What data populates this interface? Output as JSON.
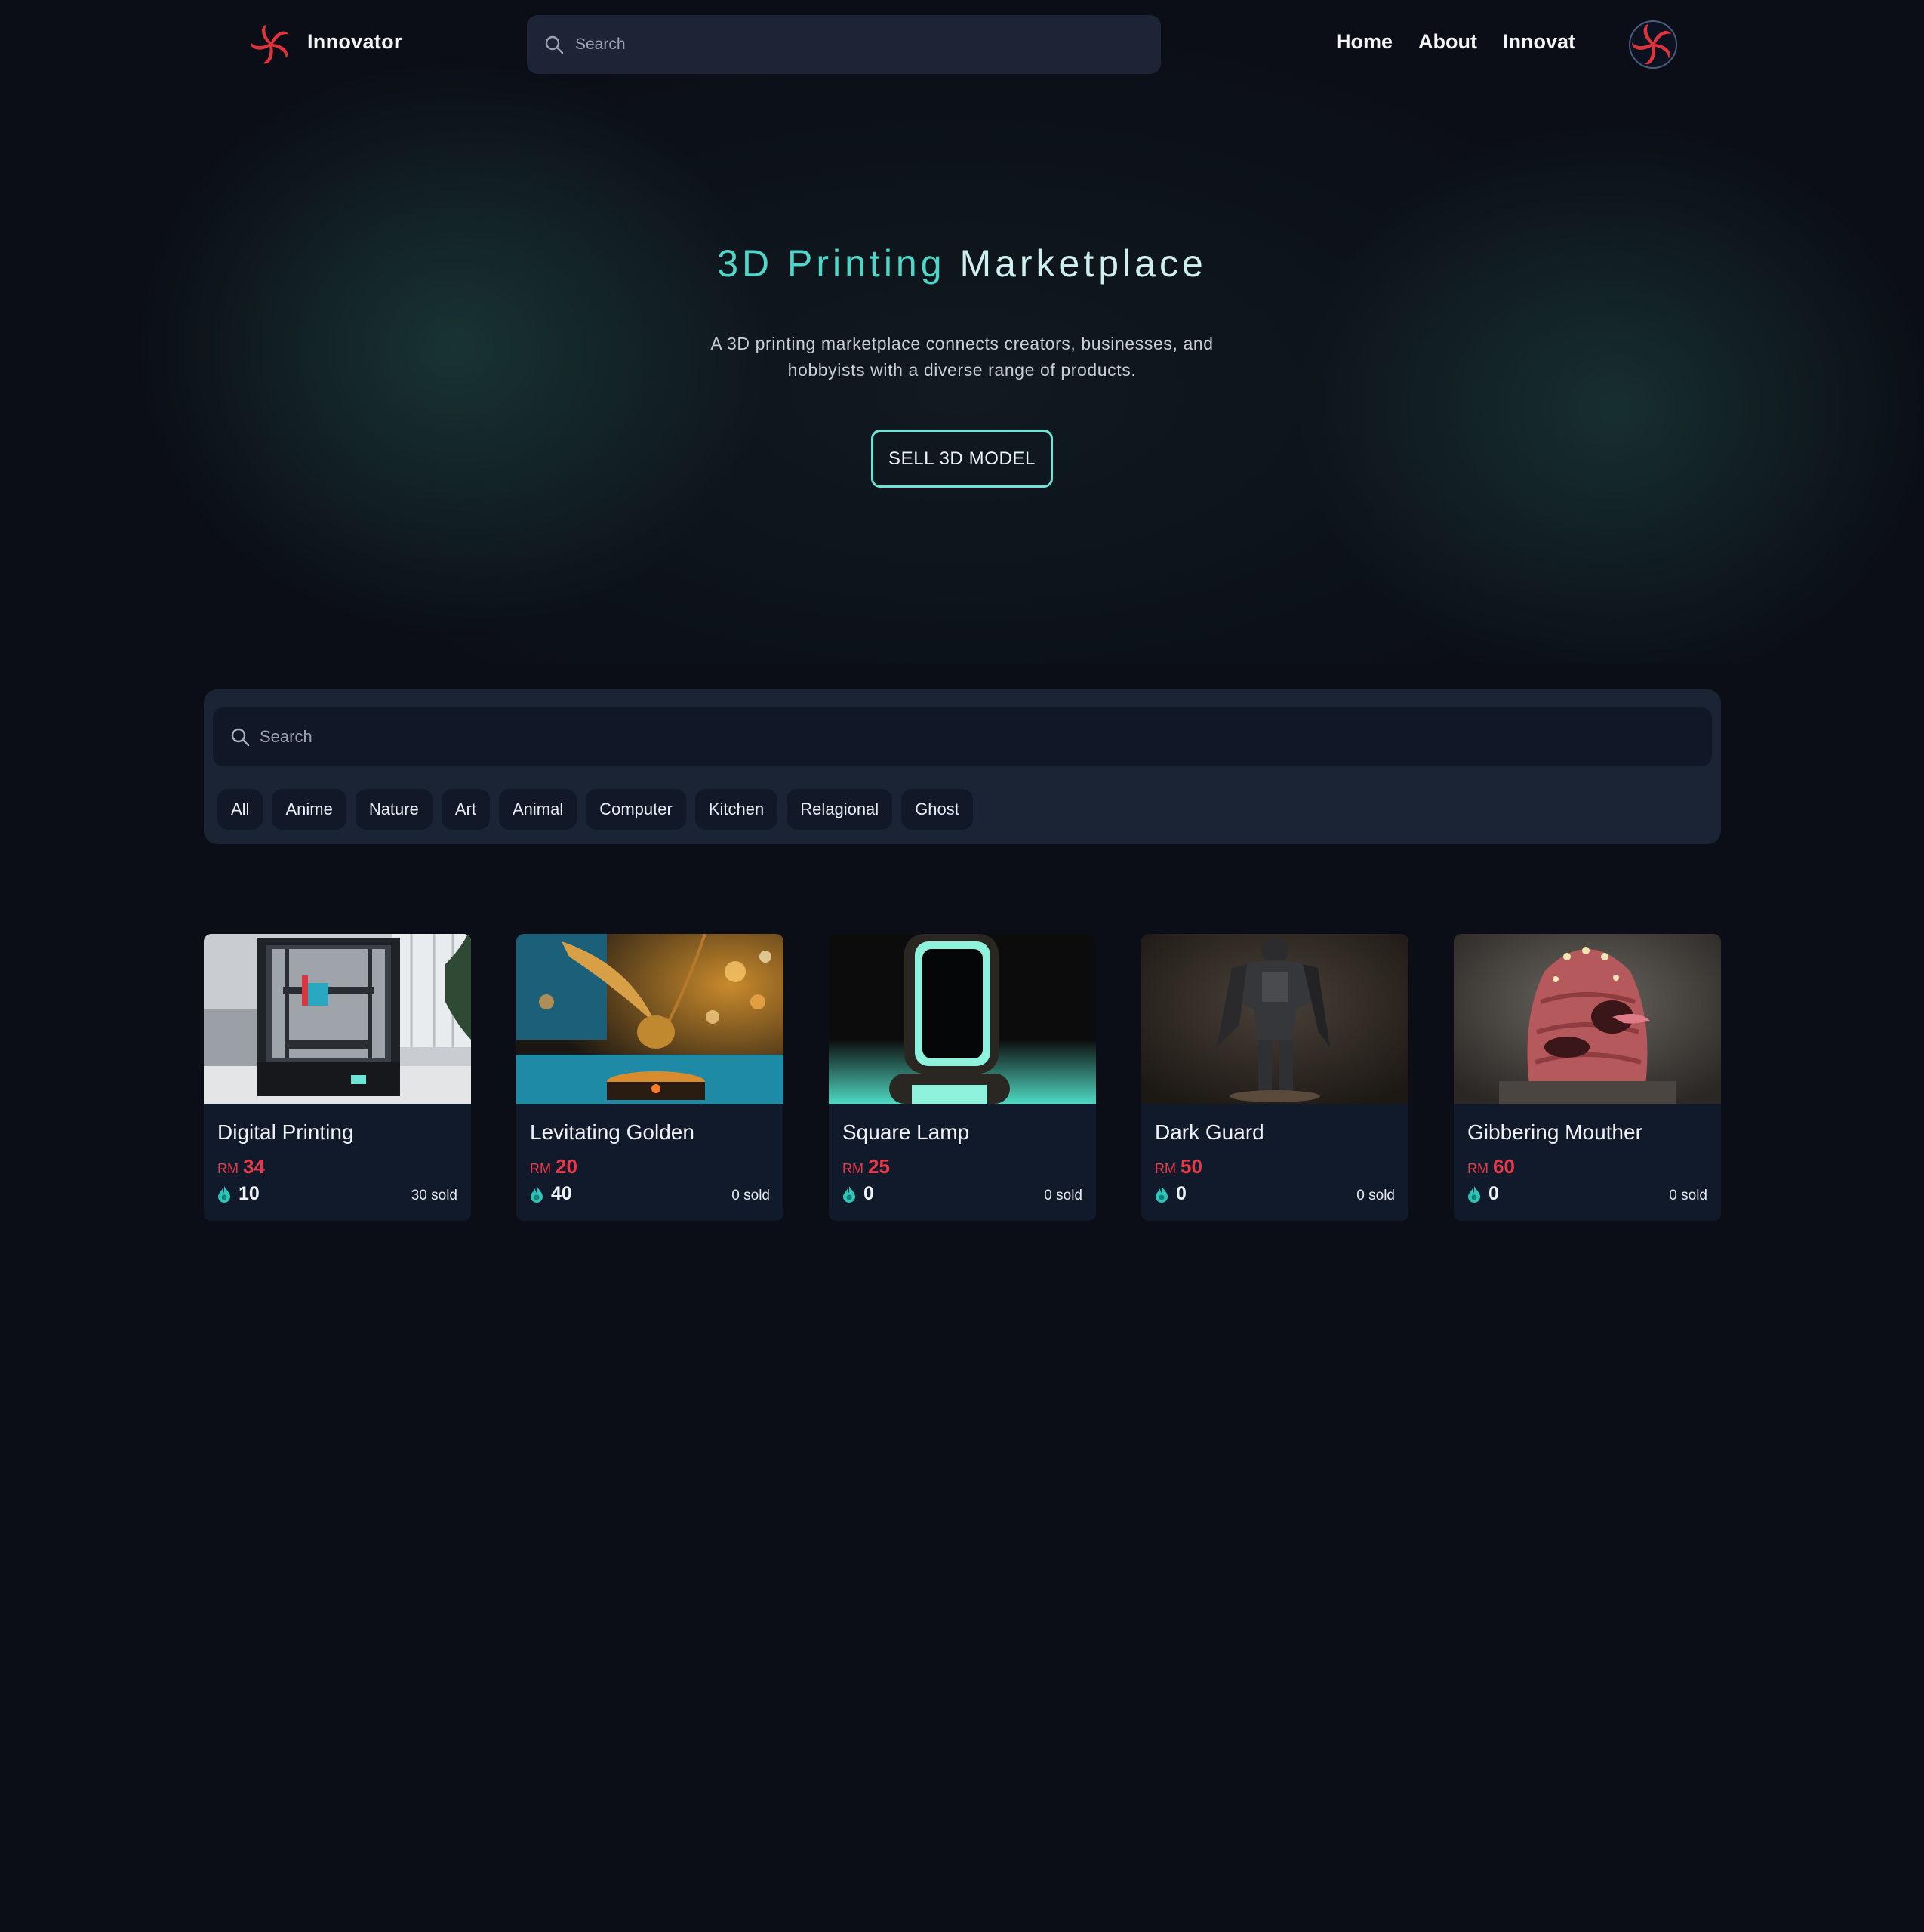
{
  "nav": {
    "brand": "Innovator",
    "logo_icon": "pinwheel-logo-icon",
    "search_placeholder": "Search",
    "links": [
      "Home",
      "About",
      "Innovat"
    ]
  },
  "hero": {
    "title_accent": "3D Printing",
    "title_rest": " Marketplace",
    "description": "A 3D printing marketplace connects creators, businesses, and hobbyists with a diverse range of products.",
    "cta": "SELL 3D MODEL"
  },
  "filters": {
    "search_placeholder": "Search",
    "categories": [
      "All",
      "Anime",
      "Nature",
      "Art",
      "Animal",
      "Computer",
      "Kitchen",
      "Relagional",
      "Ghost"
    ]
  },
  "products": [
    {
      "name": "Digital Printing",
      "currency": "RM",
      "price": "34",
      "likes": "10",
      "sold": "30 sold"
    },
    {
      "name": "Levitating Golden",
      "currency": "RM",
      "price": "20",
      "likes": "40",
      "sold": "0 sold"
    },
    {
      "name": "Square Lamp",
      "currency": "RM",
      "price": "25",
      "likes": "0",
      "sold": "0 sold"
    },
    {
      "name": "Dark Guard",
      "currency": "RM",
      "price": "50",
      "likes": "0",
      "sold": "0 sold"
    },
    {
      "name": "Gibbering Mouther",
      "currency": "RM",
      "price": "60",
      "likes": "0",
      "sold": "0 sold"
    }
  ],
  "colors": {
    "background": "#0b0e16",
    "accent_teal": "#4fd6c8",
    "price_red": "#e83a4a",
    "logo_red": "#e0343d",
    "panel": "#1b2434"
  }
}
